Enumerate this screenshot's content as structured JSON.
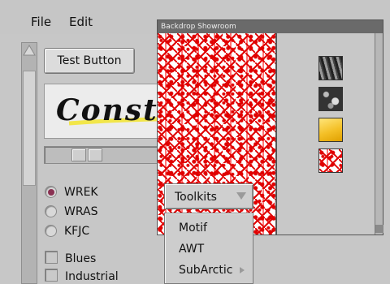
{
  "menubar": {
    "file_label": "File",
    "edit_label": "Edit"
  },
  "main": {
    "test_button_label": "Test Button",
    "logo_text": "Constructor",
    "slider_value": 0.12,
    "radios": [
      {
        "label": "WREK",
        "selected": true
      },
      {
        "label": "WRAS",
        "selected": false
      },
      {
        "label": "KFJC",
        "selected": false
      }
    ],
    "checkboxes": [
      {
        "label": "Blues",
        "checked": false
      },
      {
        "label": "Industrial",
        "checked": false
      }
    ]
  },
  "showroom": {
    "title": "Backdrop Showroom",
    "swatches": [
      "dark-stripes",
      "gray-rock",
      "gold-gradient",
      "red-lace"
    ]
  },
  "toolkits": {
    "label": "Toolkits",
    "items": [
      {
        "label": "Motif"
      },
      {
        "label": "AWT"
      },
      {
        "label": "SubArctic",
        "has_submenu": true
      }
    ]
  },
  "colors": {
    "accent_radio": "#8a3152",
    "pattern_red": "#e00000",
    "logo_highlight": "#f2e64a"
  }
}
